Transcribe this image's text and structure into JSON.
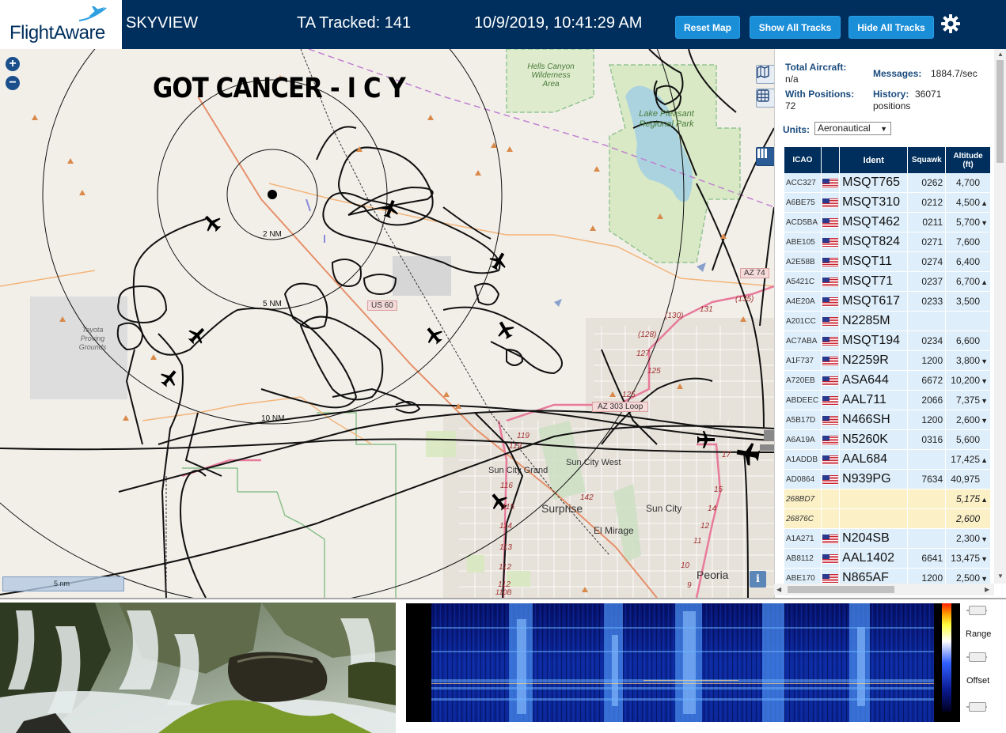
{
  "header": {
    "logo_text": "FlightAware",
    "site_name": "SKYVIEW",
    "tracked": "TA Tracked: 141",
    "datetime": "10/9/2019, 10:41:29 AM",
    "buttons": {
      "reset_map": "Reset Map",
      "show_all_tracks": "Show All Tracks",
      "hide_all_tracks": "Hide All Tracks"
    }
  },
  "map": {
    "overlay_text": "GOT CANCER - I C Y",
    "zoom_in": "+",
    "zoom_out": "−",
    "scale_label": "5 nm",
    "info_label": "i",
    "range_rings": [
      "2 NM",
      "5 NM",
      "10 NM"
    ],
    "places": {
      "hells_canyon": "Hells Canyon Wilderness Area",
      "lake_pleasant": "Lake Pleasant Regional Park",
      "toyota": "Toyota Proving Grounds",
      "sun_city_grand": "Sun City Grand",
      "sun_city_west": "Sun City West",
      "surprise": "Surprise",
      "sun_city": "Sun City",
      "el_mirage": "El Mirage",
      "peoria": "Peoria"
    },
    "roads": {
      "az74": "AZ 74",
      "us60": "US 60",
      "az303": "AZ 303 Loop",
      "r130": "(130)",
      "r131": "131",
      "r135": "(135)",
      "r128": "(128)",
      "r127": "127",
      "r125a": "125",
      "r125b": "125",
      "r119a": "119",
      "r119b": "119",
      "r116": "116",
      "r115": "115",
      "r114": "114",
      "r113": "113",
      "r112a": "112",
      "r112b": "112",
      "r110b": "110B",
      "r142": "142",
      "r17": "17",
      "r15": "15",
      "r14": "14",
      "r12": "12",
      "r11": "11",
      "r10": "10",
      "r9": "9"
    }
  },
  "panel": {
    "total_aircraft_label": "Total Aircraft:",
    "total_aircraft_value": "n/a",
    "messages_label": "Messages:",
    "messages_value": "1884.7/sec",
    "with_positions_label": "With Positions:",
    "with_positions_value": "72",
    "history_label": "History:",
    "history_value": "36071",
    "history_unit": "positions",
    "units_label": "Units:",
    "units_value": "Aeronautical",
    "columns": {
      "icao": "ICAO",
      "ident": "Ident",
      "squawk": "Squawk",
      "altitude": "Altitude",
      "altitude_unit": "(ft)"
    },
    "rows": [
      {
        "icao": "ACC327",
        "flag": "us",
        "ident": "MSQT765",
        "squawk": "0262",
        "alt": "4,700",
        "trend": ""
      },
      {
        "icao": "A6BE75",
        "flag": "us",
        "ident": "MSQT310",
        "squawk": "0212",
        "alt": "4,500",
        "trend": "▲"
      },
      {
        "icao": "ACD5BA",
        "flag": "us",
        "ident": "MSQT462",
        "squawk": "0211",
        "alt": "5,700",
        "trend": "▼"
      },
      {
        "icao": "ABE105",
        "flag": "us",
        "ident": "MSQT824",
        "squawk": "0271",
        "alt": "7,600",
        "trend": ""
      },
      {
        "icao": "A2E58B",
        "flag": "us",
        "ident": "MSQT11",
        "squawk": "0274",
        "alt": "6,400",
        "trend": ""
      },
      {
        "icao": "A5421C",
        "flag": "us",
        "ident": "MSQT71",
        "squawk": "0237",
        "alt": "6,700",
        "trend": "▲"
      },
      {
        "icao": "A4E20A",
        "flag": "us",
        "ident": "MSQT617",
        "squawk": "0233",
        "alt": "3,500",
        "trend": ""
      },
      {
        "icao": "A201CC",
        "flag": "us",
        "ident": "N2285M",
        "squawk": "",
        "alt": "",
        "trend": ""
      },
      {
        "icao": "AC7ABA",
        "flag": "us",
        "ident": "MSQT194",
        "squawk": "0234",
        "alt": "6,600",
        "trend": ""
      },
      {
        "icao": "A1F737",
        "flag": "us",
        "ident": "N2259R",
        "squawk": "1200",
        "alt": "3,800",
        "trend": "▼"
      },
      {
        "icao": "A720EB",
        "flag": "us",
        "ident": "ASA644",
        "squawk": "6672",
        "alt": "10,200",
        "trend": "▼"
      },
      {
        "icao": "ABDEEC",
        "flag": "us",
        "ident": "AAL711",
        "squawk": "2066",
        "alt": "7,375",
        "trend": "▼"
      },
      {
        "icao": "A5B17D",
        "flag": "us",
        "ident": "N466SH",
        "squawk": "1200",
        "alt": "2,600",
        "trend": "▼"
      },
      {
        "icao": "A6A19A",
        "flag": "us",
        "ident": "N5260K",
        "squawk": "0316",
        "alt": "5,600",
        "trend": ""
      },
      {
        "icao": "A1ADDB",
        "flag": "us",
        "ident": "AAL684",
        "squawk": "",
        "alt": "17,425",
        "trend": "▲"
      },
      {
        "icao": "AD0864",
        "flag": "us",
        "ident": "N939PG",
        "squawk": "7634",
        "alt": "40,975",
        "trend": ""
      },
      {
        "icao": "268BD7",
        "flag": "",
        "ident": "",
        "squawk": "",
        "alt": "5,175",
        "trend": "▲",
        "other": true
      },
      {
        "icao": "26876C",
        "flag": "",
        "ident": "",
        "squawk": "",
        "alt": "2,600",
        "trend": "",
        "other": true
      },
      {
        "icao": "A1A271",
        "flag": "us",
        "ident": "N204SB",
        "squawk": "",
        "alt": "2,300",
        "trend": "▼"
      },
      {
        "icao": "AB8112",
        "flag": "us",
        "ident": "AAL1402",
        "squawk": "6641",
        "alt": "13,475",
        "trend": "▼"
      },
      {
        "icao": "ABE170",
        "flag": "us",
        "ident": "N865AF",
        "squawk": "1200",
        "alt": "2,500",
        "trend": "▼"
      }
    ]
  },
  "bottom": {
    "range_label": "Range",
    "offset_label": "Offset"
  },
  "colors": {
    "header_bg": "#002f5d",
    "button_bg": "#1b8ed8",
    "row_bg": "#deeefa",
    "other_row_bg": "#fbf0c6",
    "map_bg": "#f2efe9"
  }
}
